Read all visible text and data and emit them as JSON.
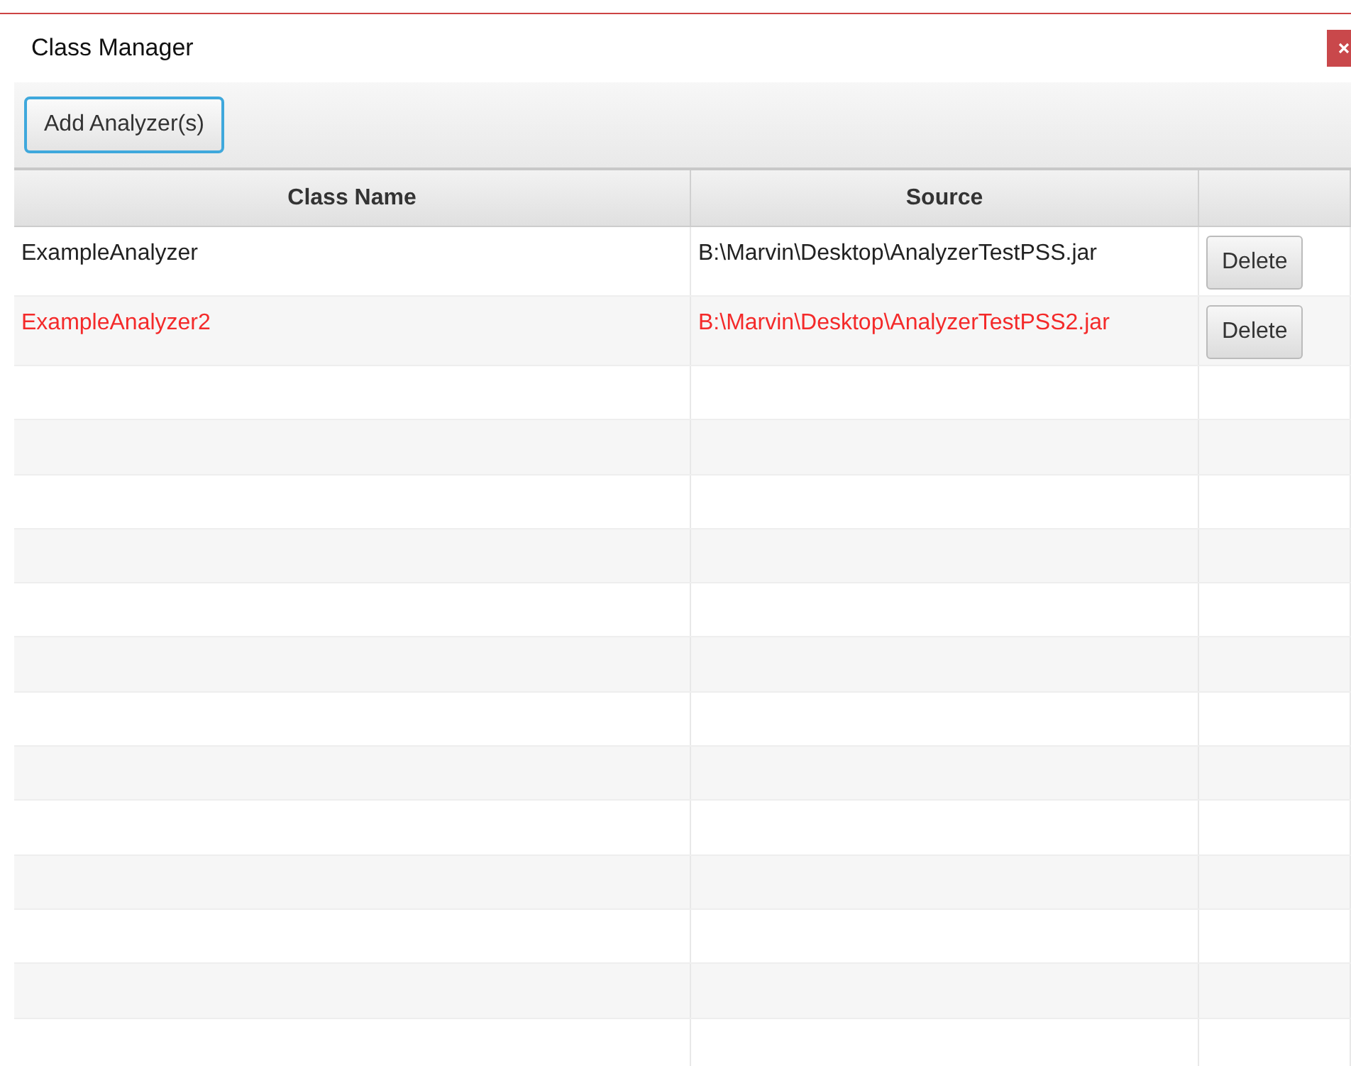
{
  "window": {
    "title": "Class Manager"
  },
  "toolbar": {
    "add_button": "Add Analyzer(s)"
  },
  "table": {
    "columns": [
      "Class Name",
      "Source",
      ""
    ],
    "rows": [
      {
        "class_name": "ExampleAnalyzer",
        "source": "B:\\Marvin\\Desktop\\AnalyzerTestPSS.jar",
        "action": "Delete",
        "invalid": false
      },
      {
        "class_name": "ExampleAnalyzer2",
        "source": "B:\\Marvin\\Desktop\\AnalyzerTestPSS2.jar",
        "action": "Delete",
        "invalid": true
      }
    ]
  }
}
